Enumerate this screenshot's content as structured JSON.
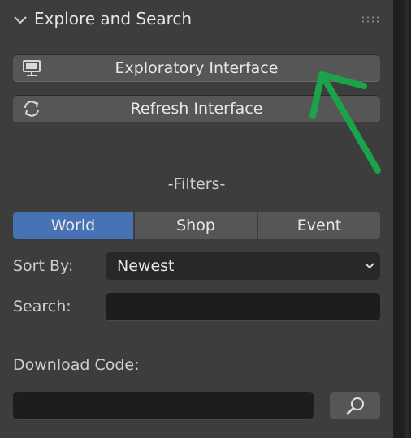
{
  "panel": {
    "title": "Explore and Search"
  },
  "buttons": {
    "exploratory": "Exploratory Interface",
    "refresh": "Refresh Interface"
  },
  "filters": {
    "heading": "-Filters-",
    "tabs": [
      {
        "label": "World",
        "active": true
      },
      {
        "label": "Shop",
        "active": false
      },
      {
        "label": "Event",
        "active": false
      }
    ],
    "sort_label": "Sort By:",
    "sort_value": "Newest",
    "search_label": "Search:",
    "search_value": ""
  },
  "download": {
    "label": "Download Code:",
    "value": ""
  },
  "icons": {
    "collapse": "chevron-down-icon",
    "drag": "drag-handle-icon",
    "monitor": "monitor-icon",
    "refresh": "refresh-icon",
    "dropdown": "chevron-down-icon",
    "search": "magnifier-icon",
    "annotation": "green-arrow-icon"
  },
  "colors": {
    "accent": "#4772b3",
    "annotation": "#1aa34a"
  }
}
